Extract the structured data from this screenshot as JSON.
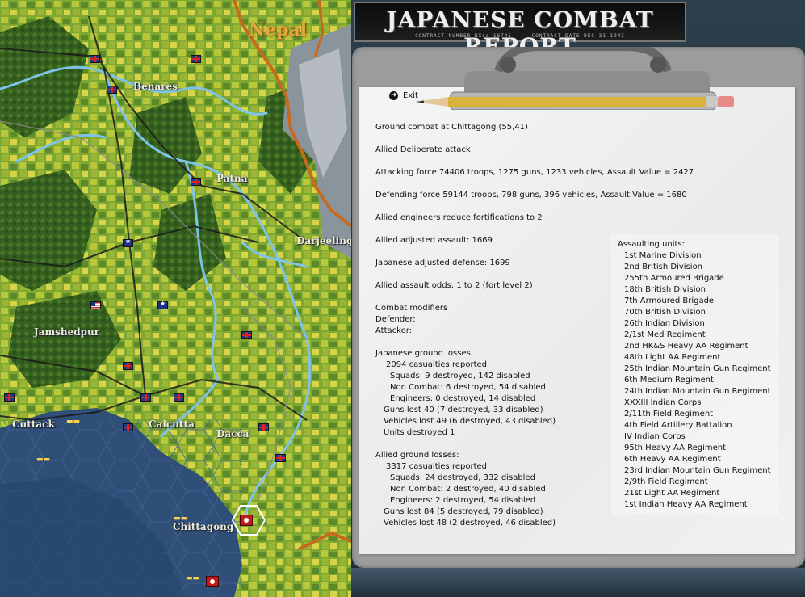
{
  "banner": {
    "title": "JAPANESE COMBAT REPORT",
    "contract_number": "CONTRACT NUMBER  NXss-18745",
    "contract_date": "CONTRACT DATE  DEC  31  1942"
  },
  "exit_label": "Exit",
  "map": {
    "region": "Nepal",
    "cities": [
      "Benares",
      "Patna",
      "Darjeeling",
      "Jamshedpur",
      "Cuttack",
      "Calcutta",
      "Dacca",
      "Chittagong"
    ]
  },
  "report": {
    "header": "Ground combat at Chittagong (55,41)",
    "attack_type": "Allied Deliberate attack",
    "attacking_force": "Attacking force 74406 troops, 1275 guns, 1233 vehicles, Assault Value = 2427",
    "defending_force": "Defending force 59144 troops, 798 guns, 396 vehicles, Assault Value = 1680",
    "engineers": "Allied engineers reduce fortifications to 2",
    "allied_adjusted": "Allied adjusted assault: 1669",
    "japanese_adjusted": "Japanese adjusted defense: 1699",
    "odds": "Allied assault odds: 1 to 2 (fort level 2)",
    "modifiers_title": "Combat modifiers",
    "defender_label": "Defender:",
    "attacker_label": "Attacker:",
    "japanese_losses": {
      "title": "Japanese ground losses:",
      "casualties": "2094 casualties reported",
      "squads": "Squads: 9 destroyed, 142 disabled",
      "non_combat": "Non Combat: 6 destroyed, 54 disabled",
      "engineers": "Engineers: 0 destroyed, 14 disabled",
      "guns": "Guns lost 40 (7 destroyed, 33 disabled)",
      "vehicles": "Vehicles lost 49 (6 destroyed, 43 disabled)",
      "units": "Units destroyed 1"
    },
    "allied_losses": {
      "title": "Allied ground losses:",
      "casualties": "3317 casualties reported",
      "squads": "Squads: 24 destroyed, 332 disabled",
      "non_combat": "Non Combat: 2 destroyed, 40 disabled",
      "engineers": "Engineers: 2 destroyed, 54 disabled",
      "guns": "Guns lost 84 (5 destroyed, 79 disabled)",
      "vehicles": "Vehicles lost 48 (2 destroyed, 46 disabled)"
    }
  },
  "assaulting_units": {
    "title": "Assaulting units:",
    "units": [
      "1st Marine Division",
      "2nd British Division",
      "255th Armoured Brigade",
      "18th British Division",
      "7th Armoured Brigade",
      "70th British Division",
      "26th Indian Division",
      "2/1st Med Regiment",
      "2nd HK&S Heavy AA Regiment",
      "48th Light AA Regiment",
      "25th Indian Mountain Gun Regiment",
      "6th Medium Regiment",
      "24th Indian Mountain Gun Regiment",
      "XXXIII Indian Corps",
      "2/11th Field Regiment",
      "4th Field Artillery Battalion",
      "IV Indian Corps",
      "95th Heavy AA Regiment",
      "6th Heavy AA Regiment",
      "23rd Indian Mountain Gun Regiment",
      "2/9th Field Regiment",
      "21st Light AA Regiment",
      "1st Indian Heavy AA Regiment"
    ]
  },
  "colors": {
    "land": "#5f8a2e",
    "forest": "#3e6b22",
    "river": "#7ec3e8",
    "sea": "#2f4e78",
    "border": "#c86a1e",
    "road": "#1a1a1a"
  }
}
